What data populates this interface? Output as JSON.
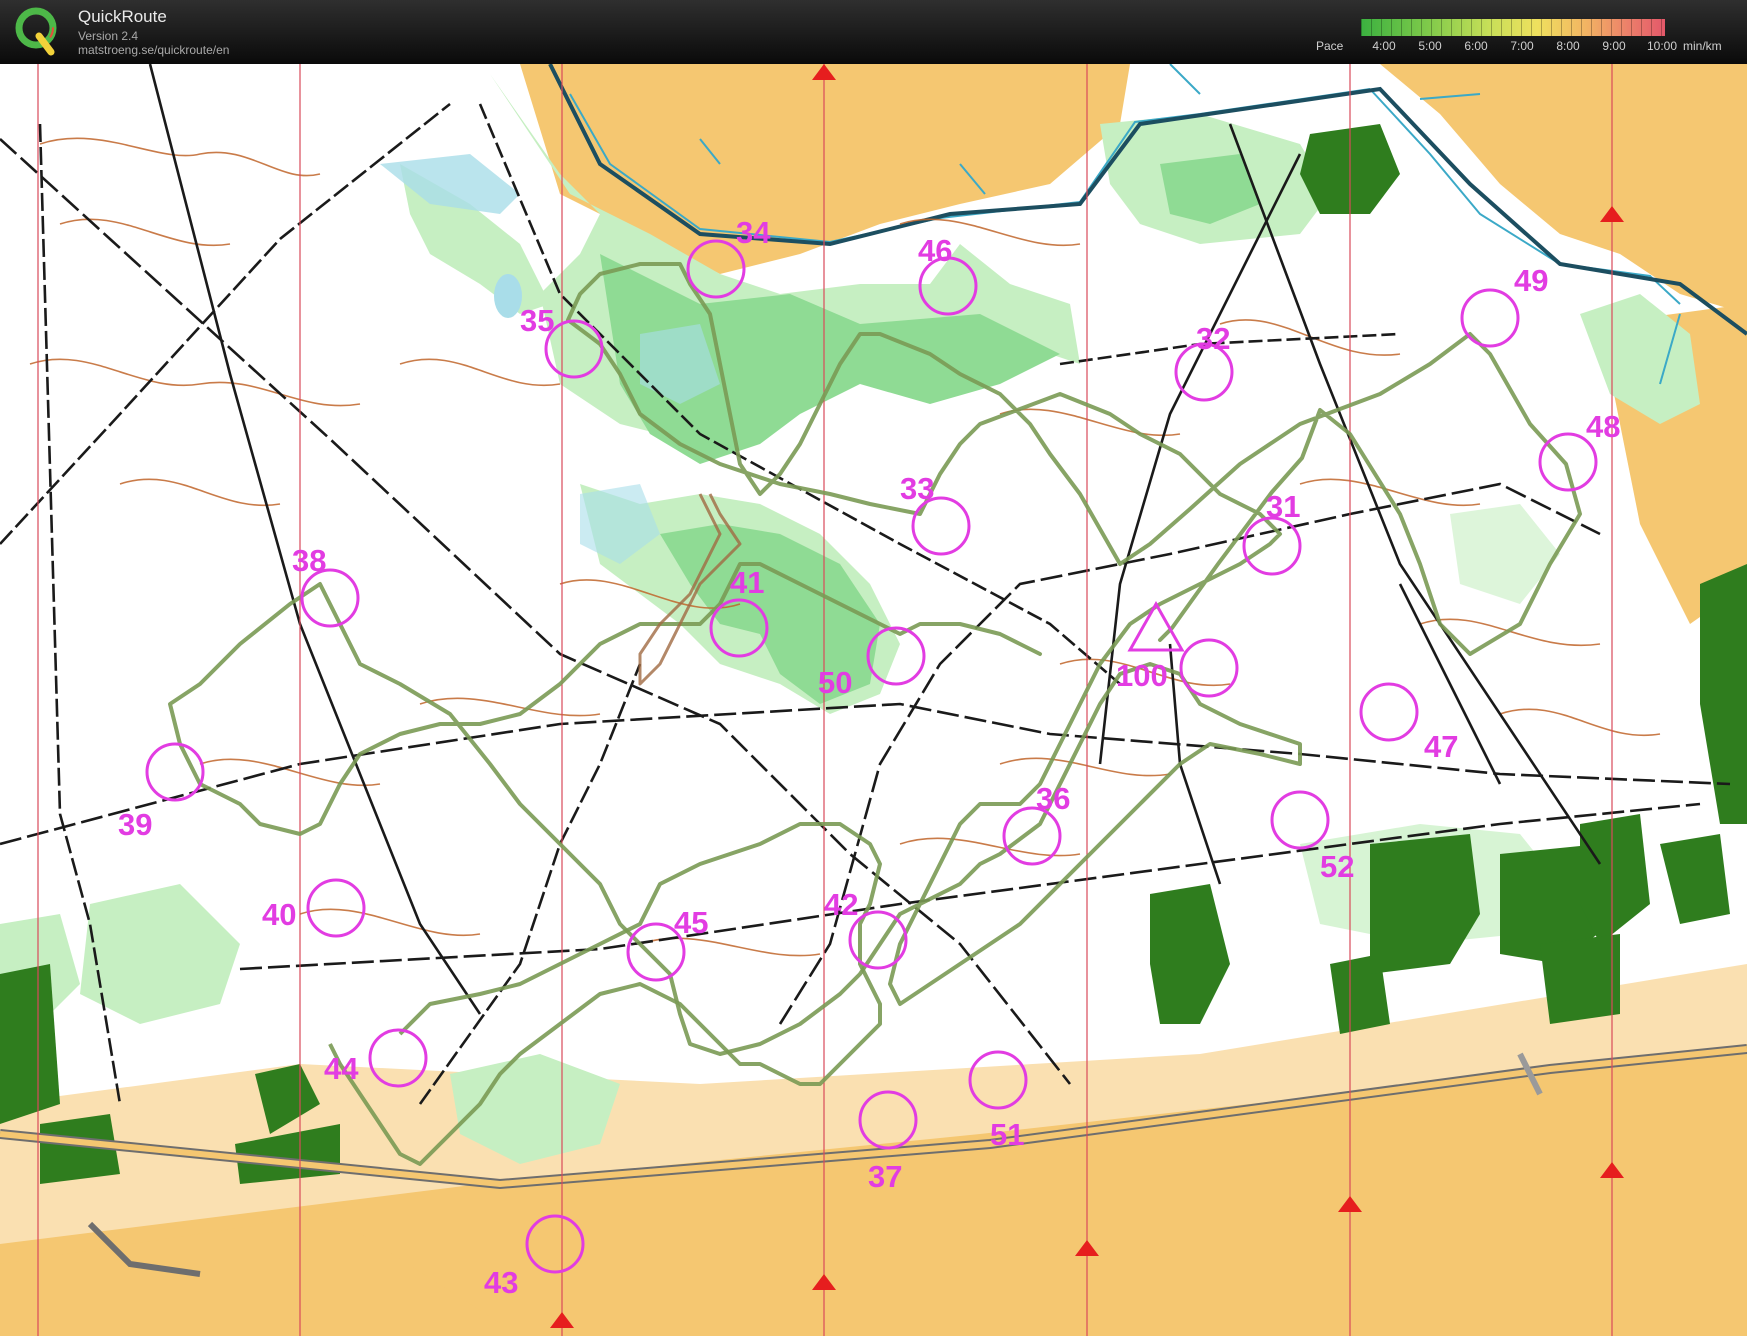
{
  "header": {
    "app_name": "QuickRoute",
    "version": "Version 2.4",
    "url": "matstroeng.se/quickroute/en",
    "logo_letter": "Q"
  },
  "pace_legend": {
    "label": "Pace",
    "ticks": [
      "4:00",
      "5:00",
      "6:00",
      "7:00",
      "8:00",
      "9:00",
      "10:00"
    ],
    "unit": "min/km"
  },
  "colors": {
    "control": "#e23ce2",
    "route": "#7a9a54",
    "north_line": "#d94a5a",
    "magnetic_north_marker": "#e61e1e",
    "forest_green_light": "#c6efc2",
    "forest_green_mid": "#7fd58a",
    "dark_green": "#2f7d1e",
    "open_land": "#f5c771",
    "marsh_blue": "#3ba9c7",
    "contour_brown": "#c0652a"
  },
  "start": {
    "label": "100"
  },
  "controls": [
    {
      "label": "31"
    },
    {
      "label": "32"
    },
    {
      "label": "33"
    },
    {
      "label": "34"
    },
    {
      "label": "35"
    },
    {
      "label": "36"
    },
    {
      "label": "37"
    },
    {
      "label": "38"
    },
    {
      "label": "39"
    },
    {
      "label": "40"
    },
    {
      "label": "41"
    },
    {
      "label": "42"
    },
    {
      "label": "43"
    },
    {
      "label": "44"
    },
    {
      "label": "45"
    },
    {
      "label": "46"
    },
    {
      "label": "47"
    },
    {
      "label": "48"
    },
    {
      "label": "49"
    },
    {
      "label": "50"
    },
    {
      "label": "51"
    },
    {
      "label": "52"
    }
  ]
}
